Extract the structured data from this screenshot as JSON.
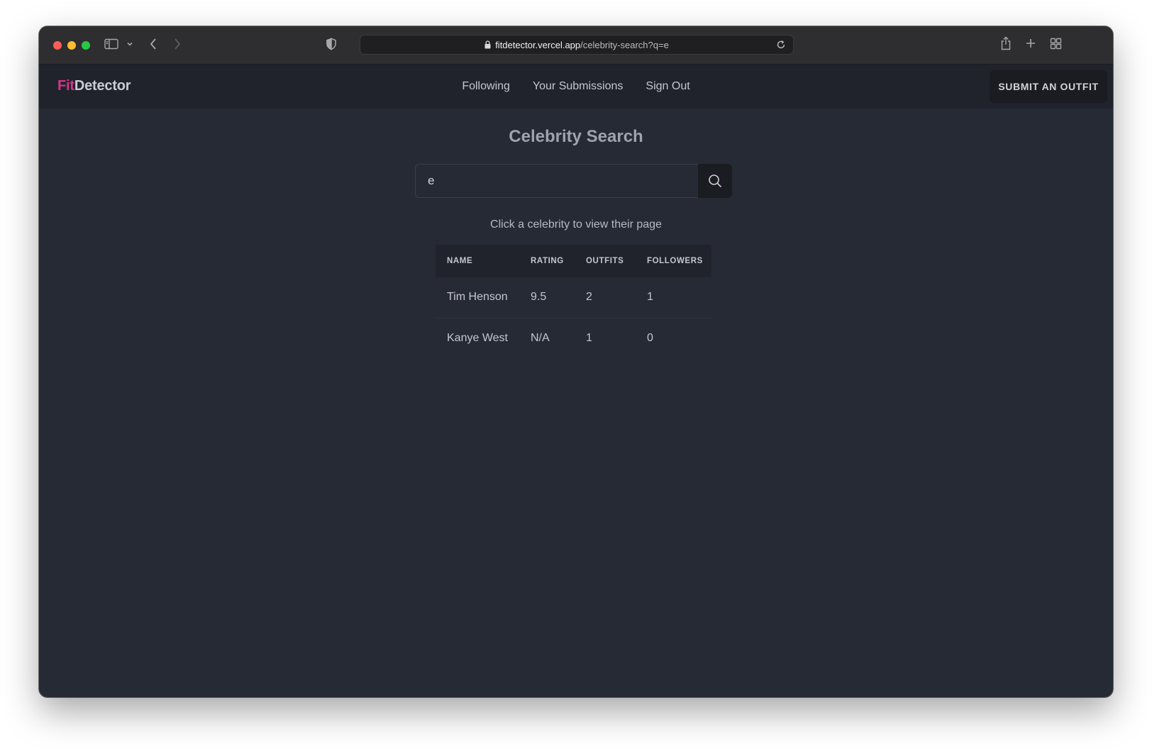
{
  "browser": {
    "url_host": "fitdetector.vercel.app",
    "url_path": "/celebrity-search?q=e"
  },
  "site": {
    "logo_part1": "Fit",
    "logo_part2": "Detector",
    "logo_accent_color": "#d6338c",
    "nav": {
      "following": "Following",
      "submissions": "Your Submissions",
      "sign_out": "Sign Out"
    },
    "submit_label": "SUBMIT AN OUTFIT"
  },
  "search": {
    "title": "Celebrity Search",
    "query": "e",
    "hint": "Click a celebrity to view their page"
  },
  "table": {
    "headers": {
      "name": "NAME",
      "rating": "RATING",
      "outfits": "OUTFITS",
      "followers": "FOLLOWERS"
    },
    "rows": [
      {
        "name": "Tim Henson",
        "rating": "9.5",
        "outfits": "2",
        "followers": "1"
      },
      {
        "name": "Kanye West",
        "rating": "N/A",
        "outfits": "1",
        "followers": "0"
      }
    ]
  }
}
